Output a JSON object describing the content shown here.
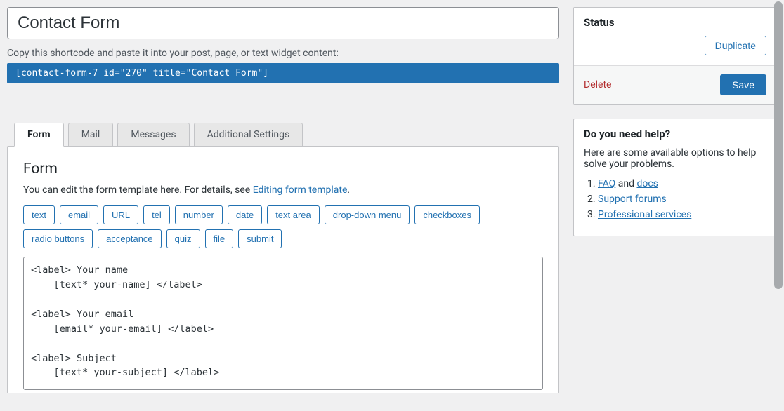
{
  "form": {
    "title": "Contact Form",
    "shortcode_hint": "Copy this shortcode and paste it into your post, page, or text widget content:",
    "shortcode": "[contact-form-7 id=\"270\" title=\"Contact Form\"]"
  },
  "tabs": [
    {
      "label": "Form",
      "active": true
    },
    {
      "label": "Mail",
      "active": false
    },
    {
      "label": "Messages",
      "active": false
    },
    {
      "label": "Additional Settings",
      "active": false
    }
  ],
  "panel": {
    "heading": "Form",
    "desc_prefix": "You can edit the form template here. For details, see ",
    "desc_link": "Editing form template",
    "desc_suffix": ".",
    "tags": [
      "text",
      "email",
      "URL",
      "tel",
      "number",
      "date",
      "text area",
      "drop-down menu",
      "checkboxes",
      "radio buttons",
      "acceptance",
      "quiz",
      "file",
      "submit"
    ],
    "template": "<label> Your name\n    [text* your-name] </label>\n\n<label> Your email\n    [email* your-email] </label>\n\n<label> Subject\n    [text* your-subject] </label>"
  },
  "status": {
    "title": "Status",
    "duplicate": "Duplicate",
    "delete": "Delete",
    "save": "Save"
  },
  "help": {
    "title": "Do you need help?",
    "intro": "Here are some available options to help solve your problems.",
    "items": [
      {
        "prefix": "",
        "link1": "FAQ",
        "mid": " and ",
        "link2": "docs"
      },
      {
        "prefix": "",
        "link1": "Support forums",
        "mid": "",
        "link2": ""
      },
      {
        "prefix": "",
        "link1": "Professional services",
        "mid": "",
        "link2": ""
      }
    ]
  }
}
